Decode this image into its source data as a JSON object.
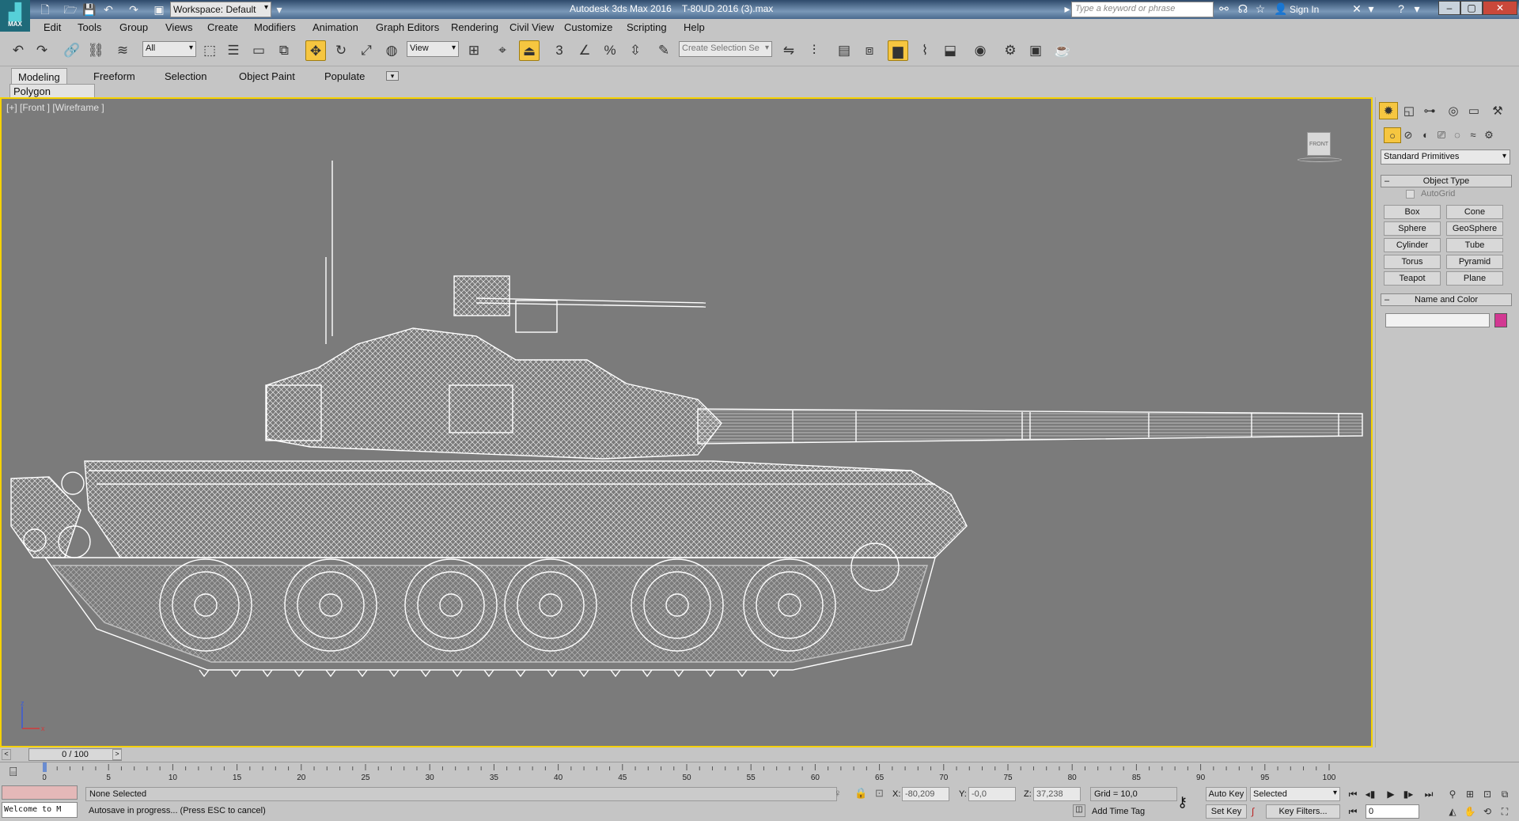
{
  "titlebar": {
    "logo_text": "MAX",
    "workspace": "Workspace: Default",
    "app_title": "Autodesk 3ds Max 2016",
    "file_title": "T-80UD 2016 (3).max",
    "search_placeholder": "Type a keyword or phrase",
    "sign_in": "Sign In"
  },
  "menu": [
    "Edit",
    "Tools",
    "Group",
    "Views",
    "Create",
    "Modifiers",
    "Animation",
    "Graph Editors",
    "Rendering",
    "Civil View",
    "Customize",
    "Scripting",
    "Help"
  ],
  "toolbar": {
    "filter": "All",
    "ref_coord": "View",
    "selection_set": "Create Selection Se"
  },
  "ribbon": {
    "tabs": [
      "Modeling",
      "Freeform",
      "Selection",
      "Object Paint",
      "Populate"
    ],
    "panel": "Polygon Modeling"
  },
  "viewport": {
    "label": "[+] [Front ] [Wireframe ]",
    "viewcube": "FRONT",
    "axis_z": "z",
    "axis_x": "x"
  },
  "command_panel": {
    "category": "Standard Primitives",
    "object_type_title": "Object Type",
    "autogrid": "AutoGrid",
    "primitives": [
      "Box",
      "Cone",
      "Sphere",
      "GeoSphere",
      "Cylinder",
      "Tube",
      "Torus",
      "Pyramid",
      "Teapot",
      "Plane"
    ],
    "name_color_title": "Name and Color",
    "object_color": "#d23892"
  },
  "timeline": {
    "position": "0 / 100",
    "ticks": [
      "0",
      "5",
      "10",
      "15",
      "20",
      "25",
      "30",
      "35",
      "40",
      "45",
      "50",
      "55",
      "60",
      "65",
      "70",
      "75",
      "80",
      "85",
      "90",
      "95",
      "100"
    ]
  },
  "status": {
    "maxscript_welcome": "Welcome to M",
    "selection": "None Selected",
    "prompt": "Autosave in progress... (Press ESC to cancel)",
    "x_label": "X:",
    "x_value": "-80,209",
    "y_label": "Y:",
    "y_value": "-0,0",
    "z_label": "Z:",
    "z_value": "37,238",
    "grid": "Grid = 10,0",
    "add_time_tag": "Add Time Tag",
    "auto_key": "Auto Key",
    "set_key": "Set Key",
    "key_mode": "Selected",
    "key_filters": "Key Filters...",
    "current_frame": "0"
  }
}
